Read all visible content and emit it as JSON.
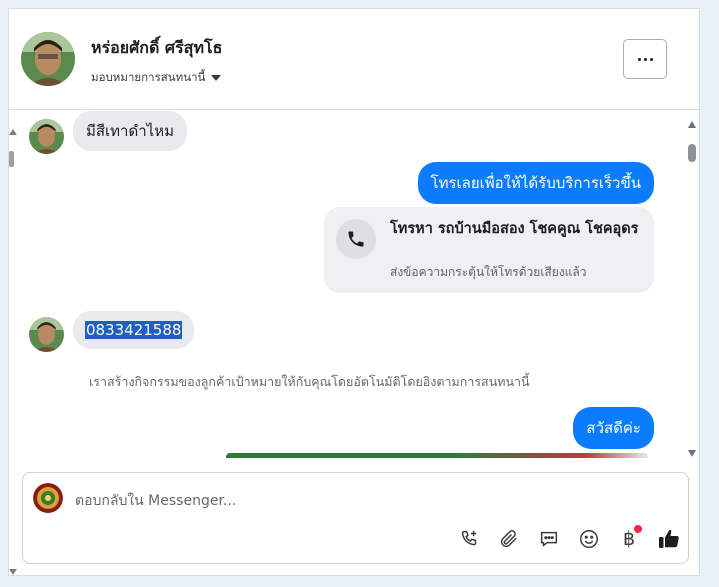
{
  "header": {
    "name": "หร่อยศักดิ์ ศรีสุทโธ",
    "assign_label": "มอบหมายการสนทนานี้"
  },
  "messages": {
    "incoming_1": "มีสีเทาดำไหม",
    "outgoing_1": "โทรเลยเพื่อให้ได้รับบริการเร็วขึ้น",
    "call_card": {
      "title": "โทรหา รถบ้านมือสอง โชคคูณ โชคอุดร",
      "subtitle": "ส่งข้อความกระตุ้นให้โทรด้วยเสียงแล้ว"
    },
    "incoming_2": "0833421588",
    "system_note": "เราสร้างกิจกรรมของลูกค้าเป้าหมายให้กับคุณโดยอัตโนมัติโดยอิงตามการสนทนานี้",
    "outgoing_2": "สวัสดีค่ะ"
  },
  "composer": {
    "placeholder": "ตอบกลับใน Messenger..."
  },
  "tools": {
    "baht_symbol": "฿"
  },
  "colors": {
    "outgoing_bubble": "#0a7cff",
    "incoming_bubble": "#e9eaed",
    "selection": "#1f5fbf",
    "notification_dot": "#f02849"
  }
}
